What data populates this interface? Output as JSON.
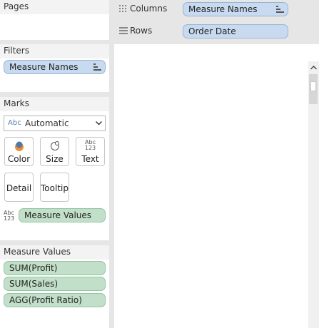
{
  "pages": {
    "title": "Pages"
  },
  "columns_shelf": {
    "label": "Columns",
    "pill": "Measure Names"
  },
  "rows_shelf": {
    "label": "Rows",
    "pill": "Order Date"
  },
  "filters": {
    "title": "Filters",
    "pills": [
      "Measure Names"
    ]
  },
  "marks": {
    "title": "Marks",
    "mark_type_icon": "Abc",
    "mark_type": "Automatic",
    "buttons": {
      "color": "Color",
      "size": "Size",
      "text": "Text",
      "detail": "Detail",
      "tooltip": "Tooltip"
    },
    "text_icon_top": "Abc",
    "text_icon_bottom": "123",
    "values_icon_top": "Abc",
    "values_icon_bottom": "123",
    "values_pill": "Measure Values"
  },
  "measure_values": {
    "title": "Measure Values",
    "items": [
      "SUM(Profit)",
      "SUM(Sales)",
      "AGG(Profit Ratio)"
    ]
  },
  "colors": {
    "blue_pill": "#c8daef",
    "green_pill": "#c2e0c9",
    "background": "#e6e6e6"
  }
}
